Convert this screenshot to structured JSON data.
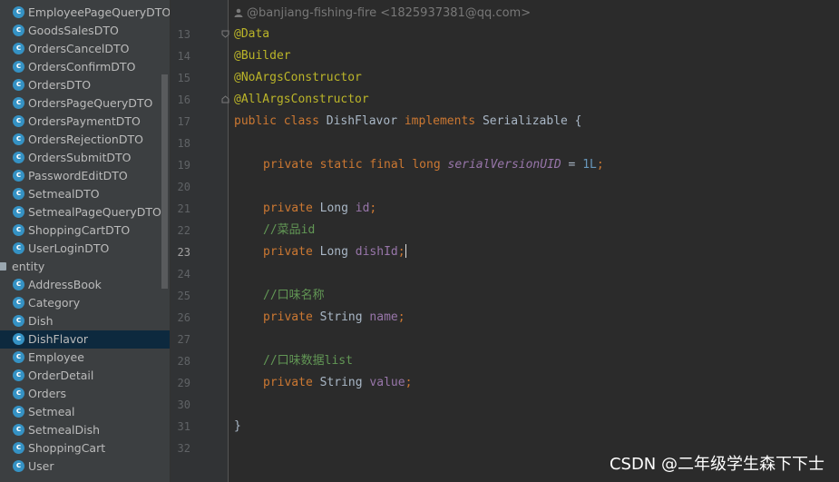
{
  "sidebar": {
    "items": [
      {
        "label": "EmployeePageQueryDTO",
        "kind": "class"
      },
      {
        "label": "GoodsSalesDTO",
        "kind": "class"
      },
      {
        "label": "OrdersCancelDTO",
        "kind": "class"
      },
      {
        "label": "OrdersConfirmDTO",
        "kind": "class"
      },
      {
        "label": "OrdersDTO",
        "kind": "class"
      },
      {
        "label": "OrdersPageQueryDTO",
        "kind": "class"
      },
      {
        "label": "OrdersPaymentDTO",
        "kind": "class"
      },
      {
        "label": "OrdersRejectionDTO",
        "kind": "class"
      },
      {
        "label": "OrdersSubmitDTO",
        "kind": "class"
      },
      {
        "label": "PasswordEditDTO",
        "kind": "class"
      },
      {
        "label": "SetmealDTO",
        "kind": "class"
      },
      {
        "label": "SetmealPageQueryDTO",
        "kind": "class"
      },
      {
        "label": "ShoppingCartDTO",
        "kind": "class"
      },
      {
        "label": "UserLoginDTO",
        "kind": "class"
      },
      {
        "label": "entity",
        "kind": "package"
      },
      {
        "label": "AddressBook",
        "kind": "class"
      },
      {
        "label": "Category",
        "kind": "class"
      },
      {
        "label": "Dish",
        "kind": "class"
      },
      {
        "label": "DishFlavor",
        "kind": "class",
        "selected": true
      },
      {
        "label": "Employee",
        "kind": "class"
      },
      {
        "label": "OrderDetail",
        "kind": "class"
      },
      {
        "label": "Orders",
        "kind": "class"
      },
      {
        "label": "Setmeal",
        "kind": "class"
      },
      {
        "label": "SetmealDish",
        "kind": "class"
      },
      {
        "label": "ShoppingCart",
        "kind": "class"
      },
      {
        "label": "User",
        "kind": "class"
      }
    ],
    "class_icon_letter": "c",
    "icons": {
      "class": "class-icon",
      "package": "folder-icon"
    }
  },
  "editor": {
    "author": "@banjiang-fishing-fire <1825937381@qq.com>",
    "author_icon": "person-icon",
    "current_line": 23,
    "lines": [
      {
        "n": "13",
        "tokens": [
          {
            "t": "@Data",
            "c": "ann"
          }
        ]
      },
      {
        "n": "14",
        "tokens": [
          {
            "t": "@Builder",
            "c": "ann"
          }
        ]
      },
      {
        "n": "15",
        "tokens": [
          {
            "t": "@NoArgsConstructor",
            "c": "ann"
          }
        ]
      },
      {
        "n": "16",
        "tokens": [
          {
            "t": "@AllArgsConstructor",
            "c": "ann"
          }
        ]
      },
      {
        "n": "17",
        "tokens": [
          {
            "t": "public class ",
            "c": "kw"
          },
          {
            "t": "DishFlavor ",
            "c": "type"
          },
          {
            "t": "implements ",
            "c": "kw"
          },
          {
            "t": "Serializable {",
            "c": "type"
          }
        ]
      },
      {
        "n": "18",
        "tokens": []
      },
      {
        "n": "19",
        "indent": true,
        "tokens": [
          {
            "t": "private static final long ",
            "c": "kw"
          },
          {
            "t": "serialVersionUID",
            "c": "static"
          },
          {
            "t": " = ",
            "c": "type"
          },
          {
            "t": "1L",
            "c": "num"
          },
          {
            "t": ";",
            "c": "kw"
          }
        ]
      },
      {
        "n": "20",
        "tokens": []
      },
      {
        "n": "21",
        "indent": true,
        "tokens": [
          {
            "t": "private ",
            "c": "kw"
          },
          {
            "t": "Long ",
            "c": "type"
          },
          {
            "t": "id",
            "c": "field"
          },
          {
            "t": ";",
            "c": "kw"
          }
        ]
      },
      {
        "n": "22",
        "indent": true,
        "tokens": [
          {
            "t": "//菜品id",
            "c": "comment"
          }
        ]
      },
      {
        "n": "23",
        "indent": true,
        "caret": true,
        "tokens": [
          {
            "t": "private ",
            "c": "kw"
          },
          {
            "t": "Long ",
            "c": "type"
          },
          {
            "t": "dishId",
            "c": "field"
          },
          {
            "t": ";",
            "c": "kw"
          }
        ]
      },
      {
        "n": "24",
        "tokens": []
      },
      {
        "n": "25",
        "indent": true,
        "tokens": [
          {
            "t": "//口味名称",
            "c": "comment"
          }
        ]
      },
      {
        "n": "26",
        "indent": true,
        "tokens": [
          {
            "t": "private ",
            "c": "kw"
          },
          {
            "t": "String ",
            "c": "type"
          },
          {
            "t": "name",
            "c": "field"
          },
          {
            "t": ";",
            "c": "kw"
          }
        ]
      },
      {
        "n": "27",
        "tokens": []
      },
      {
        "n": "28",
        "indent": true,
        "tokens": [
          {
            "t": "//口味数据list",
            "c": "comment"
          }
        ]
      },
      {
        "n": "29",
        "indent": true,
        "tokens": [
          {
            "t": "private ",
            "c": "kw"
          },
          {
            "t": "String ",
            "c": "type"
          },
          {
            "t": "value",
            "c": "field"
          },
          {
            "t": ";",
            "c": "kw"
          }
        ]
      },
      {
        "n": "30",
        "tokens": []
      },
      {
        "n": "31",
        "tokens": [
          {
            "t": "}",
            "c": "type"
          }
        ]
      },
      {
        "n": "32",
        "tokens": []
      }
    ]
  },
  "watermark": "CSDN @二年级学生森下下士",
  "colors": {
    "sidebar_bg": "#3c3f41",
    "editor_bg": "#2b2b2b",
    "selection": "#0d293e",
    "keyword": "#cc7832",
    "annotation": "#bbb529",
    "field": "#9876aa",
    "number": "#6897bb",
    "comment": "#629755",
    "class_icon": "#3592c4"
  }
}
